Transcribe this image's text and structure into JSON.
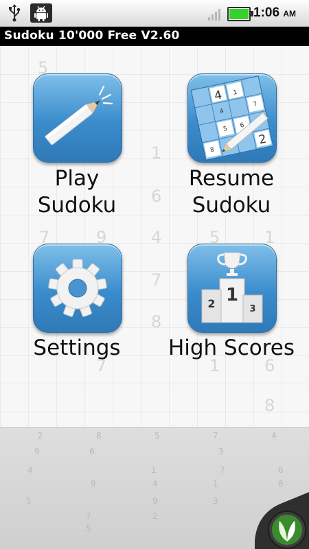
{
  "status_bar": {
    "time": "1:06",
    "ampm": "AM"
  },
  "app": {
    "title": "Sudoku 10'000 Free V2.60"
  },
  "menu": {
    "play": [
      "Play",
      "Sudoku"
    ],
    "resume": [
      "Resume",
      "Sudoku"
    ],
    "settings": "Settings",
    "high_scores": "High Scores"
  },
  "resume_icon_digits": [
    "4",
    "1",
    "7",
    "6",
    "8",
    "2",
    "5",
    "4"
  ],
  "podium_digits": [
    "2",
    "1",
    "3"
  ],
  "background_digits": [
    "5",
    "1",
    "6",
    "4",
    "7",
    "9",
    "5",
    "1",
    "7",
    "8",
    "1",
    "6",
    "7",
    "8"
  ],
  "floor_digits": [
    "2",
    "8",
    "5",
    "7",
    "4",
    "9",
    "6",
    "3",
    "4",
    "1",
    "7",
    "6",
    "9",
    "4",
    "1",
    "8",
    "5",
    "9",
    "3",
    "7",
    "2",
    "5"
  ],
  "icons": {
    "usb": "usb-icon",
    "android": "android-debug-icon",
    "signal": "signal-icon",
    "battery": "battery-icon",
    "play": "pencil-icon",
    "resume": "sudoku-grid-pencil-icon",
    "settings": "gear-icon",
    "high_scores": "trophy-podium-icon",
    "corner": "leaf-logo-icon"
  },
  "colors": {
    "tile_top": "#7fbfe9",
    "tile_bottom": "#2f79b7",
    "battery_fill": "#36d12a",
    "title_bar": "#000000"
  }
}
